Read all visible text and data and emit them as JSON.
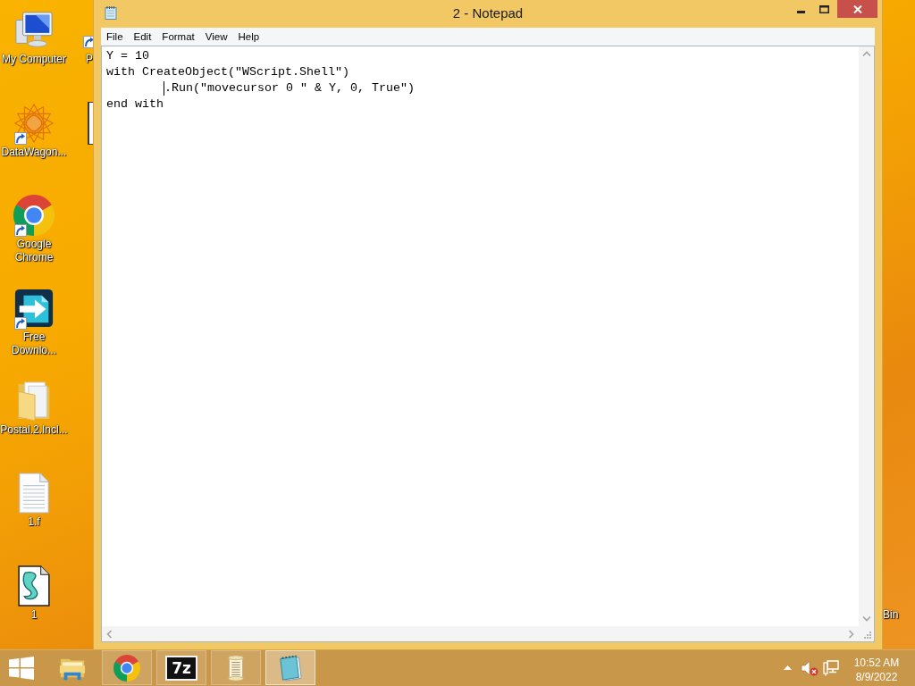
{
  "desktop": {
    "icons": [
      {
        "kind": "computer",
        "label": "My Computer",
        "shortcut": false
      },
      {
        "kind": "star-emblem",
        "label": "DataWagon...",
        "shortcut": true
      },
      {
        "kind": "browser",
        "label": "Google Chrome",
        "shortcut": true
      },
      {
        "kind": "download-app",
        "label": "Free Downlo...",
        "shortcut": true
      },
      {
        "kind": "folder",
        "label": "Postal.2.Incl...",
        "shortcut": false
      },
      {
        "kind": "text-file",
        "label": "1.f",
        "shortcut": false
      },
      {
        "kind": "script-file",
        "label": "1",
        "shortcut": false
      }
    ],
    "partly_hidden_icons": [
      {
        "kind": "shortcut",
        "label": "P"
      },
      {
        "kind": "file"
      }
    ],
    "edge_icons": [
      {
        "label": "Bin"
      }
    ]
  },
  "window": {
    "title": "2 - Notepad",
    "menu": [
      "File",
      "Edit",
      "Format",
      "View",
      "Help"
    ],
    "lines": [
      {
        "text": "Y = 10",
        "caret": false
      },
      {
        "text": "with CreateObject(\"WScript.Shell\")",
        "caret": false
      },
      {
        "text": "\t.Run(\"movecursor 0 \" & Y, 0, True\")",
        "caret": true
      },
      {
        "text": "end with",
        "caret": false
      }
    ]
  },
  "taskbar": {
    "apps": [
      {
        "kind": "folder",
        "running": false,
        "selected": false
      },
      {
        "kind": "browser",
        "running": true,
        "selected": false
      },
      {
        "kind": "archiver",
        "logo_text": "7z",
        "running": true,
        "selected": false
      },
      {
        "kind": "scroll",
        "running": true,
        "selected": false
      },
      {
        "kind": "notepad",
        "running": true,
        "selected": true
      }
    ],
    "tray": {
      "volume_muted": true,
      "time": "10:52 AM",
      "date": "8/9/2022"
    }
  }
}
